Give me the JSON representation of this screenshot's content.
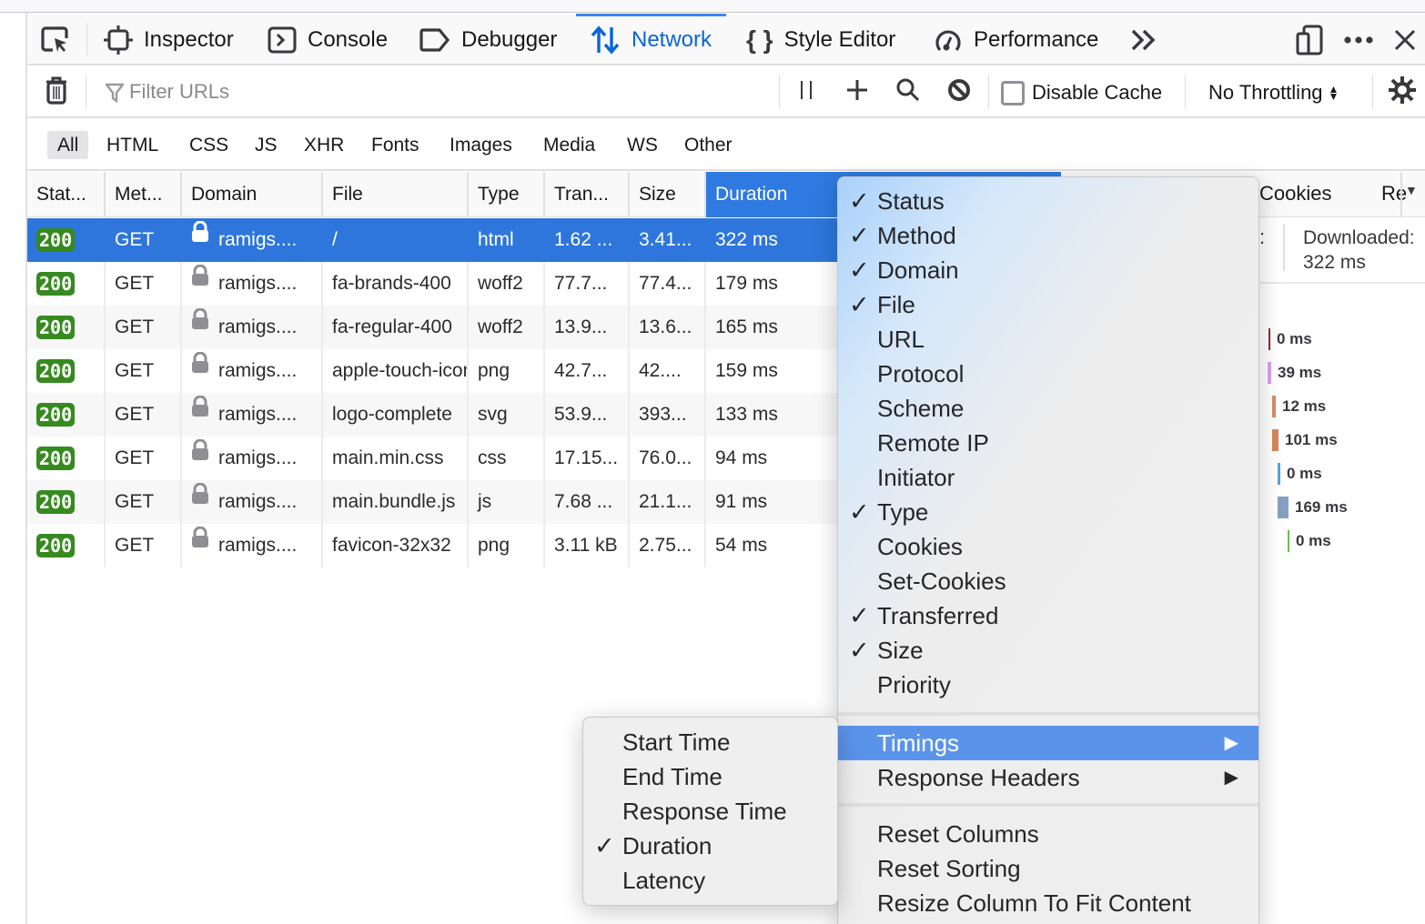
{
  "toolbox": {
    "tabs": [
      {
        "label": "Inspector",
        "icon": "inspector-icon"
      },
      {
        "label": "Console",
        "icon": "console-icon"
      },
      {
        "label": "Debugger",
        "icon": "debugger-icon"
      },
      {
        "label": "Network",
        "icon": "network-icon",
        "selected": true
      },
      {
        "label": "Style Editor",
        "icon": "style-editor-icon"
      },
      {
        "label": "Performance",
        "icon": "performance-icon"
      }
    ],
    "accent_color": "#0a64d8"
  },
  "netbar": {
    "filter_placeholder": "Filter URLs",
    "disable_cache_label": "Disable Cache",
    "disable_cache_checked": false,
    "throttling_value": "No Throttling"
  },
  "type_filters": [
    "All",
    "HTML",
    "CSS",
    "JS",
    "XHR",
    "Fonts",
    "Images",
    "Media",
    "WS",
    "Other"
  ],
  "type_filter_active": "All",
  "table": {
    "columns": [
      "Stat...",
      "Met...",
      "Domain",
      "File",
      "Type",
      "Tran...",
      "Size",
      "Duration"
    ],
    "sorted_column": "Duration",
    "rows": [
      {
        "status": "200",
        "method": "GET",
        "domain": "ramigs....",
        "file": "/",
        "type": "html",
        "transferred": "1.62 ...",
        "size": "3.41...",
        "duration": "322 ms",
        "selected": true
      },
      {
        "status": "200",
        "method": "GET",
        "domain": "ramigs....",
        "file": "fa-brands-400",
        "type": "woff2",
        "transferred": "77.7...",
        "size": "77.4...",
        "duration": "179 ms"
      },
      {
        "status": "200",
        "method": "GET",
        "domain": "ramigs....",
        "file": "fa-regular-400",
        "type": "woff2",
        "transferred": "13.9...",
        "size": "13.6...",
        "duration": "165 ms"
      },
      {
        "status": "200",
        "method": "GET",
        "domain": "ramigs....",
        "file": "apple-touch-icon",
        "type": "png",
        "transferred": "42.7...",
        "size": "42....",
        "duration": "159 ms"
      },
      {
        "status": "200",
        "method": "GET",
        "domain": "ramigs....",
        "file": "logo-complete",
        "type": "svg",
        "transferred": "53.9...",
        "size": "393...",
        "duration": "133 ms"
      },
      {
        "status": "200",
        "method": "GET",
        "domain": "ramigs....",
        "file": "main.min.css",
        "type": "css",
        "transferred": "17.15...",
        "size": "76.0...",
        "duration": "94 ms"
      },
      {
        "status": "200",
        "method": "GET",
        "domain": "ramigs....",
        "file": "main.bundle.js",
        "type": "js",
        "transferred": "7.68 ...",
        "size": "21.1...",
        "duration": "91 ms"
      },
      {
        "status": "200",
        "method": "GET",
        "domain": "ramigs....",
        "file": "favicon-32x32",
        "type": "png",
        "transferred": "3.11 kB",
        "size": "2.75...",
        "duration": "54 ms"
      }
    ]
  },
  "side_panel": {
    "tabs": [
      "Cookies",
      "Re"
    ],
    "downloaded_label": "Downloaded:",
    "downloaded_value": "322 ms",
    "timings": [
      {
        "value": "0 ms",
        "color": "#a4202a"
      },
      {
        "value": "39 ms",
        "color": "#d7a0ec"
      },
      {
        "value": "12 ms",
        "color": "#d58d66"
      },
      {
        "value": "101 ms",
        "color": "#d7875a"
      },
      {
        "value": "0 ms",
        "color": "#5ba0d8"
      },
      {
        "value": "169 ms",
        "color": "#86a0c2"
      },
      {
        "value": "0 ms",
        "color": "#6dbf4b"
      }
    ]
  },
  "context_menu": {
    "columns": [
      {
        "label": "Status",
        "checked": true
      },
      {
        "label": "Method",
        "checked": true
      },
      {
        "label": "Domain",
        "checked": true
      },
      {
        "label": "File",
        "checked": true
      },
      {
        "label": "URL",
        "checked": false
      },
      {
        "label": "Protocol",
        "checked": false
      },
      {
        "label": "Scheme",
        "checked": false
      },
      {
        "label": "Remote IP",
        "checked": false
      },
      {
        "label": "Initiator",
        "checked": false
      },
      {
        "label": "Type",
        "checked": true
      },
      {
        "label": "Cookies",
        "checked": false
      },
      {
        "label": "Set-Cookies",
        "checked": false
      },
      {
        "label": "Transferred",
        "checked": true
      },
      {
        "label": "Size",
        "checked": true
      },
      {
        "label": "Priority",
        "checked": false
      }
    ],
    "submenus": [
      {
        "label": "Timings",
        "highlighted": true
      },
      {
        "label": "Response Headers",
        "highlighted": false
      }
    ],
    "actions": [
      "Reset Columns",
      "Reset Sorting",
      "Resize Column To Fit Content"
    ],
    "check_glyph": "✓",
    "arrow_glyph": "▶"
  },
  "timings_submenu": {
    "items": [
      {
        "label": "Start Time",
        "checked": false
      },
      {
        "label": "End Time",
        "checked": false
      },
      {
        "label": "Response Time",
        "checked": false
      },
      {
        "label": "Duration",
        "checked": true
      },
      {
        "label": "Latency",
        "checked": false
      }
    ]
  }
}
